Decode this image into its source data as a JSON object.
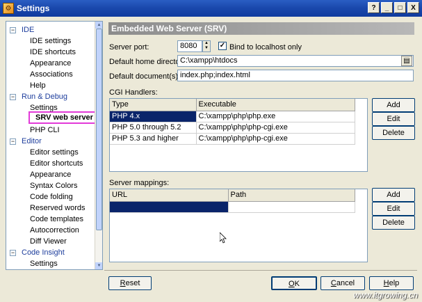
{
  "window": {
    "title": "Settings",
    "controls": [
      "?",
      "_",
      "□",
      "X"
    ]
  },
  "tree": {
    "categories": [
      {
        "label": "IDE",
        "toggle": "⊟",
        "items": [
          "IDE settings",
          "IDE shortcuts",
          "Appearance",
          "Associations",
          "Help"
        ]
      },
      {
        "label": "Run & Debug",
        "toggle": "⊟",
        "items": [
          "Settings",
          "SRV web server",
          "PHP CLI"
        ]
      },
      {
        "label": "Editor",
        "toggle": "⊟",
        "items": [
          "Editor settings",
          "Editor shortcuts",
          "Appearance",
          "Syntax Colors",
          "Code folding",
          "Reserved words",
          "Code templates",
          "Autocorrection",
          "Diff Viewer"
        ]
      },
      {
        "label": "Code Insight",
        "toggle": "⊟",
        "items": [
          "Settings"
        ]
      }
    ],
    "selected": "SRV web server"
  },
  "panel": {
    "header": "Embedded Web Server (SRV)",
    "server_port_label": "Server port:",
    "server_port_value": "8080",
    "bind_label": "Bind to localhost only",
    "bind_checked": true,
    "home_dir_label": "Default home directory",
    "home_dir_value": "C:\\xampp\\htdocs",
    "default_doc_label": "Default document(s):",
    "default_doc_value": "index.php;index.html",
    "cgi_label": "CGI Handlers:",
    "cgi_columns": [
      "Type",
      "Executable"
    ],
    "cgi_rows": [
      [
        "PHP 4.x",
        "C:\\xampp\\php\\php.exe"
      ],
      [
        "PHP 5.0 through 5.2",
        "C:\\xampp\\php\\php-cgi.exe"
      ],
      [
        "PHP 5.3 and higher",
        "C:\\xampp\\php\\php-cgi.exe"
      ]
    ],
    "mappings_label": "Server mappings:",
    "mapping_columns": [
      "URL",
      "Path"
    ],
    "side_buttons": [
      "Add",
      "Edit",
      "Delete"
    ]
  },
  "footer": {
    "reset": "Reset",
    "ok": "OK",
    "cancel": "Cancel",
    "help": "Help"
  },
  "watermark": "www.itgrowing.cn",
  "colors": {
    "selection": "#0a246a",
    "highlight_border": "#e23ad8",
    "title_bar": "#1b49ad"
  }
}
